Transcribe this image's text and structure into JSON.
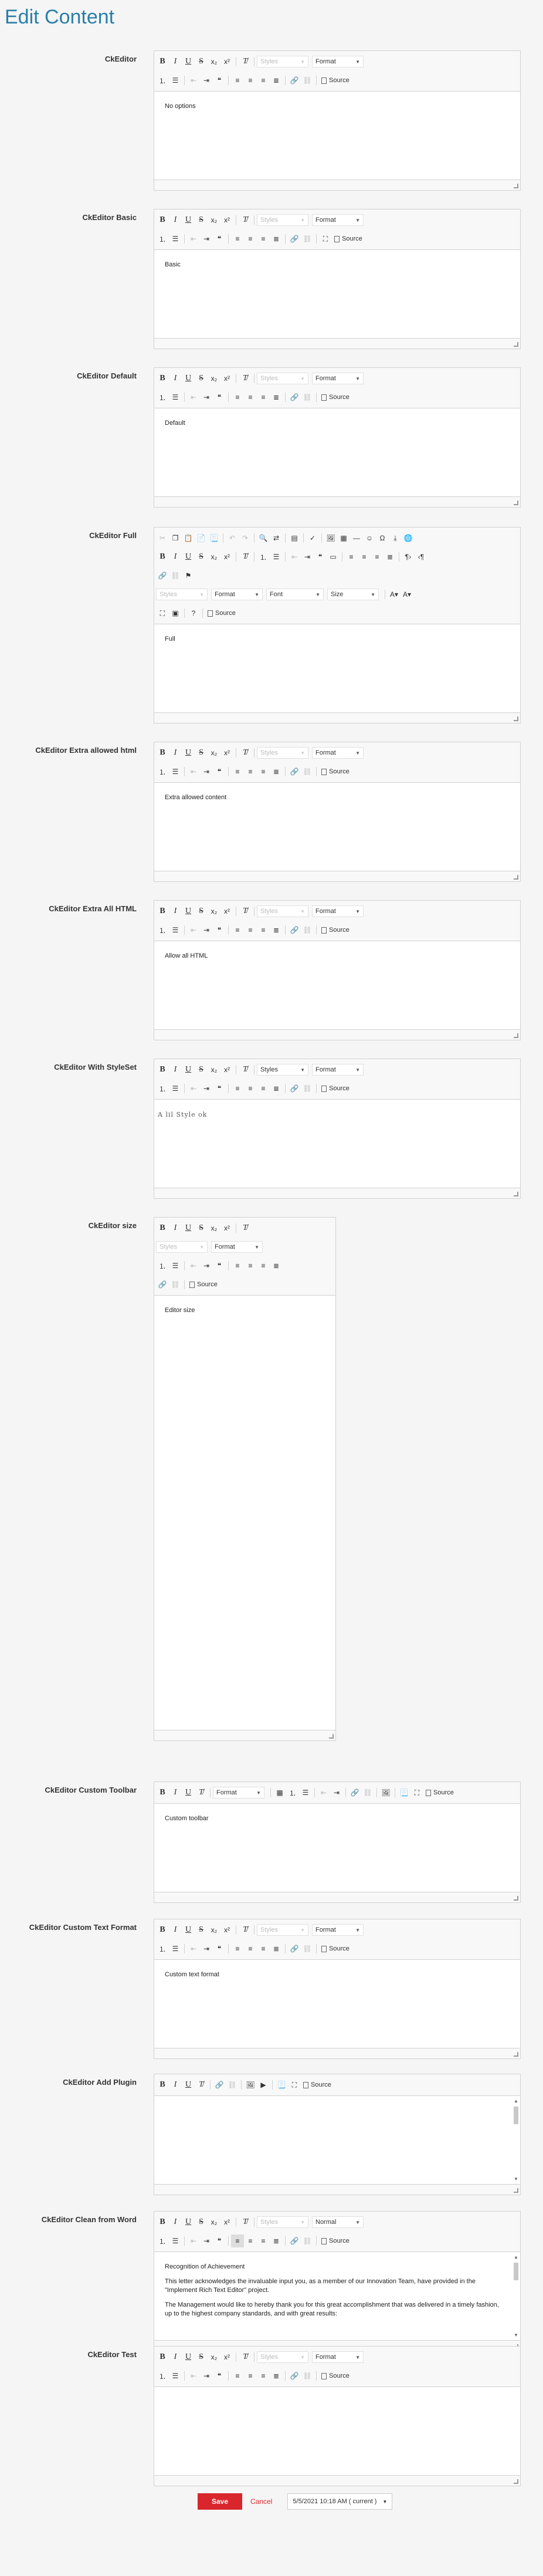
{
  "page": {
    "title": "Edit Content"
  },
  "toolbar": {
    "styles_label": "Styles",
    "format_label": "Format",
    "normal_label": "Normal",
    "font_label": "Font",
    "size_label": "Size",
    "source_label": "Source"
  },
  "editors": [
    {
      "label": "CkEditor",
      "content": [
        "No options"
      ]
    },
    {
      "label": "CkEditor Basic",
      "content": [
        "Basic"
      ]
    },
    {
      "label": "CkEditor Default",
      "content": [
        "Default"
      ]
    },
    {
      "label": "CkEditor Full",
      "content": [
        "Full"
      ]
    },
    {
      "label": "CkEditor Extra allowed html",
      "content": [
        "Extra allowed content"
      ]
    },
    {
      "label": "CkEditor Extra All HTML",
      "content": [
        "Allow all HTML"
      ]
    },
    {
      "label": "CkEditor With StyleSet",
      "content": [
        "A lil Style ok"
      ]
    },
    {
      "label": "CkEditor size",
      "content": [
        "Editor size"
      ]
    },
    {
      "label": "CkEditor Custom Toolbar",
      "content": [
        "Custom toolbar"
      ]
    },
    {
      "label": "CkEditor Custom Text Format",
      "content": [
        "Custom text format"
      ]
    },
    {
      "label": "CkEditor Add Plugin",
      "content": []
    },
    {
      "label": "CkEditor Clean from Word",
      "content": [
        "Recognition of Achievement",
        "This letter acknowledges the invaluable input you, as a member of our Innovation Team, have provided in the \"Implement Rich Text Editor\" project.",
        "The Management would like to hereby thank you for this great accomplishment that was delivered in a timely fashion, up to the highest company standards, and with great results:"
      ]
    },
    {
      "label": "CkEditor Test",
      "content": []
    }
  ],
  "actions": {
    "save_label": "Save",
    "cancel_label": "Cancel",
    "version_label": "5/5/2021 10:18 AM ( current )"
  },
  "colors": {
    "title": "#2a7fa8",
    "save_bg": "#d9262c",
    "cancel_text": "#d9262c"
  }
}
